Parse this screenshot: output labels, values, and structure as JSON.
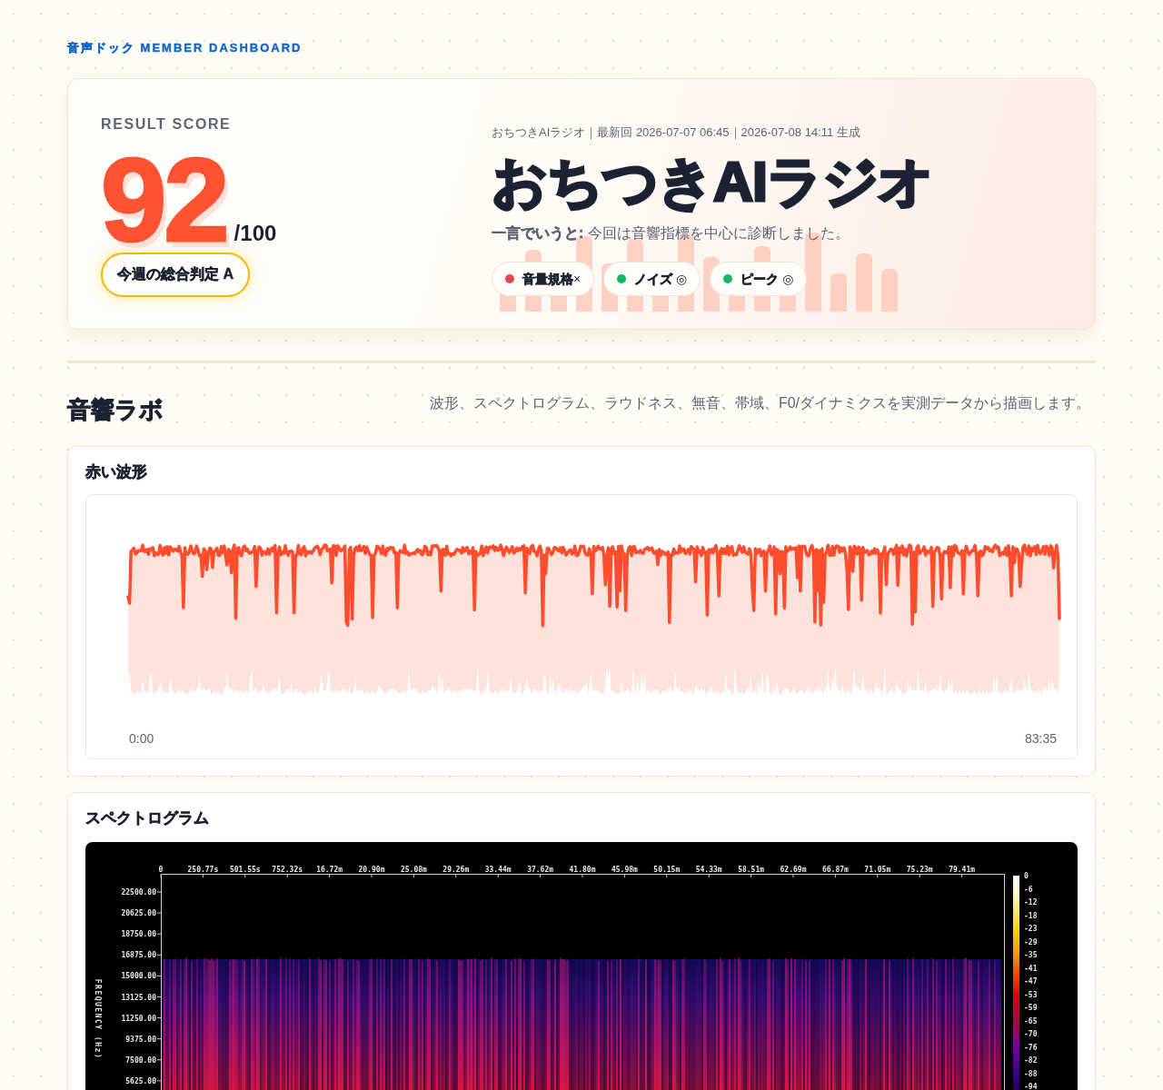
{
  "header": {
    "title": "音声ドック MEMBER DASHBOARD"
  },
  "hero": {
    "score_label": "RESULT SCORE",
    "score": "92",
    "score_max": "/100",
    "verdict": "今週の総合判定 A",
    "meta": "おちつきAIラジオ｜最新回 2026-07-07 06:45｜2026-07-08 14:11 生成",
    "title": "おちつきAIラジオ",
    "summary": "**一言でいうと:** 今回は音響指標を中心に診断しました。",
    "tags": [
      {
        "text": "**音量規格**×",
        "color": "#e5484d"
      },
      {
        "text": "**ノイズ** ◎",
        "color": "#12b76a"
      },
      {
        "text": "**ピーク** ◎",
        "color": "#12b76a"
      }
    ]
  },
  "lab": {
    "title": "音響ラボ",
    "description": "波形、スペクトログラム、ラウドネス、無音、帯域、F0/ダイナミクスを実測データから描画します。",
    "panels": [
      {
        "kind": "waveform",
        "title": "赤い波形",
        "start_time": "0:00",
        "end_time": "83:35"
      },
      {
        "kind": "spectrogram",
        "title": "スペクトログラム",
        "time_ticks": [
          "0",
          "250.77s",
          "501.55s",
          "752.32s",
          "16.72m",
          "20.90m",
          "25.08m",
          "29.26m",
          "33.44m",
          "37.62m",
          "41.80m",
          "45.98m",
          "50.15m",
          "54.33m",
          "58.51m",
          "62.69m",
          "66.87m",
          "71.05m",
          "75.23m",
          "79.41m"
        ],
        "frequency_ticks": [
          "22500.00",
          "20625.00",
          "18750.00",
          "16875.00",
          "15000.00",
          "13125.00",
          "11250.00",
          "9375.00",
          "7500.00",
          "5625.00"
        ],
        "frequency_axis_title": "FREQUENCY (Hz)",
        "scale_ticks": [
          "0",
          "-6",
          "-12",
          "-18",
          "-23",
          "-29",
          "-35",
          "-41",
          "-47",
          "-53",
          "-59",
          "-65",
          "-70",
          "-76",
          "-82",
          "-88",
          "-94"
        ]
      }
    ]
  }
}
